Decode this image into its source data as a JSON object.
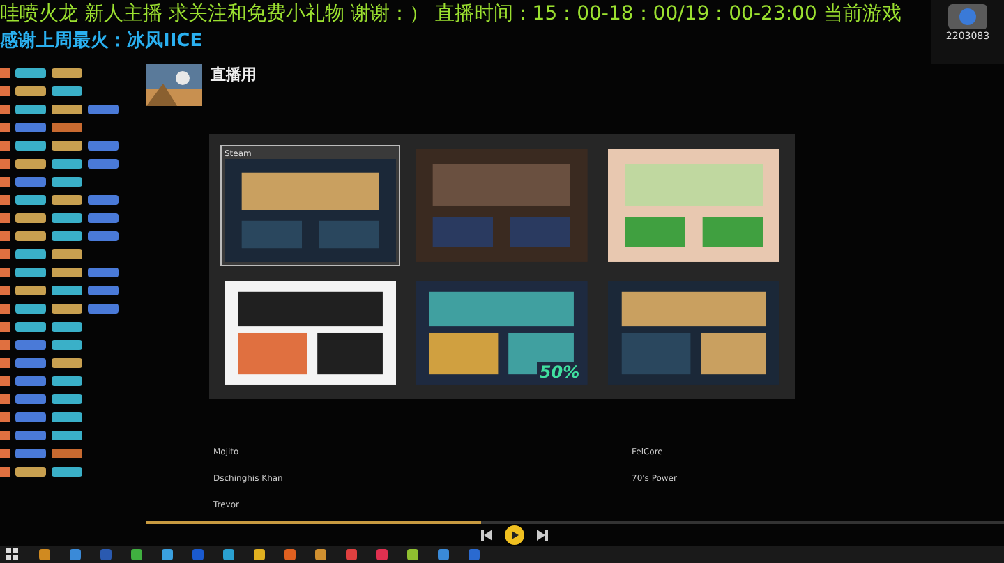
{
  "banner": {
    "line": "哇喷火龙 新人主播 求关注和免费小礼物 谢谢：） 直播时间：15：00-18：00/19：00-23:00 当前游戏",
    "thanks": "感谢上周最火：冰风IICE"
  },
  "logo": {
    "room_number": "2203083"
  },
  "playlist": {
    "title": "直播用"
  },
  "chat": [
    {
      "badges": [
        {
          "color": "#3ab0c8"
        },
        {
          "color": "#c8a050"
        }
      ]
    },
    {
      "badges": [
        {
          "color": "#c8a050"
        },
        {
          "color": "#3ab0c8"
        }
      ]
    },
    {
      "badges": [
        {
          "color": "#3ab0c8"
        },
        {
          "color": "#c8a050"
        },
        {
          "color": "#4a7ad8"
        }
      ]
    },
    {
      "badges": [
        {
          "color": "#4a7ad8"
        },
        {
          "color": "#c86a30"
        }
      ]
    },
    {
      "badges": [
        {
          "color": "#3ab0c8"
        },
        {
          "color": "#c8a050"
        },
        {
          "color": "#4a7ad8"
        }
      ]
    },
    {
      "badges": [
        {
          "color": "#c8a050"
        },
        {
          "color": "#3ab0c8"
        },
        {
          "color": "#4a7ad8"
        }
      ]
    },
    {
      "badges": [
        {
          "color": "#4a7ad8"
        },
        {
          "color": "#3ab0c8"
        }
      ]
    },
    {
      "badges": [
        {
          "color": "#3ab0c8"
        },
        {
          "color": "#c8a050"
        },
        {
          "color": "#4a7ad8"
        }
      ]
    },
    {
      "badges": [
        {
          "color": "#c8a050"
        },
        {
          "color": "#3ab0c8"
        },
        {
          "color": "#4a7ad8"
        }
      ]
    },
    {
      "badges": [
        {
          "color": "#c8a050"
        },
        {
          "color": "#3ab0c8"
        },
        {
          "color": "#4a7ad8"
        }
      ]
    },
    {
      "badges": [
        {
          "color": "#3ab0c8"
        },
        {
          "color": "#c8a050"
        }
      ]
    },
    {
      "badges": [
        {
          "color": "#3ab0c8"
        },
        {
          "color": "#c8a050"
        },
        {
          "color": "#4a7ad8"
        }
      ]
    },
    {
      "badges": [
        {
          "color": "#c8a050"
        },
        {
          "color": "#3ab0c8"
        },
        {
          "color": "#4a7ad8"
        }
      ]
    },
    {
      "badges": [
        {
          "color": "#3ab0c8"
        },
        {
          "color": "#c8a050"
        },
        {
          "color": "#4a7ad8"
        }
      ]
    },
    {
      "badges": [
        {
          "color": "#3ab0c8"
        },
        {
          "color": "#3ab0c8"
        }
      ]
    },
    {
      "badges": [
        {
          "color": "#4a7ad8"
        },
        {
          "color": "#3ab0c8"
        }
      ]
    },
    {
      "badges": [
        {
          "color": "#4a7ad8"
        },
        {
          "color": "#c8a050"
        }
      ]
    },
    {
      "badges": [
        {
          "color": "#4a7ad8"
        },
        {
          "color": "#3ab0c8"
        }
      ]
    },
    {
      "badges": [
        {
          "color": "#4a7ad8"
        },
        {
          "color": "#3ab0c8"
        }
      ]
    },
    {
      "badges": [
        {
          "color": "#4a7ad8"
        },
        {
          "color": "#3ab0c8"
        }
      ]
    },
    {
      "badges": [
        {
          "color": "#4a7ad8"
        },
        {
          "color": "#3ab0c8"
        }
      ]
    },
    {
      "badges": [
        {
          "color": "#4a7ad8"
        },
        {
          "color": "#c86a30"
        }
      ]
    },
    {
      "badges": [
        {
          "color": "#c8a050"
        },
        {
          "color": "#3ab0c8"
        }
      ]
    }
  ],
  "switcher": {
    "top": [
      {
        "title": "Steam",
        "selected": true,
        "kind": "app"
      },
      {
        "selected": false,
        "kind": "game"
      },
      {
        "selected": false,
        "kind": "art"
      }
    ],
    "bottom": [
      {
        "selected": false,
        "kind": "browser"
      },
      {
        "selected": false,
        "kind": "launcher",
        "promo": "50%"
      },
      {
        "selected": false,
        "kind": "app"
      }
    ]
  },
  "songs": [
    {
      "left": "Mojito",
      "right": "FelCore"
    },
    {
      "left": "Dschinghis Khan",
      "right": "70's Power"
    },
    {
      "left": "Trevor"
    }
  ],
  "player": {
    "level": 0.37
  },
  "taskbar": {
    "icons": [
      {
        "color": "#d08a20"
      },
      {
        "color": "#3a8ad8"
      },
      {
        "color": "#2a5ab0"
      },
      {
        "color": "#40b040"
      },
      {
        "color": "#3aa0e0"
      },
      {
        "color": "#1a5ad0"
      },
      {
        "color": "#2aa0d0"
      },
      {
        "color": "#e0b020"
      },
      {
        "color": "#e06020"
      },
      {
        "color": "#d09030"
      },
      {
        "color": "#e04040"
      },
      {
        "color": "#e03050"
      },
      {
        "color": "#90c030"
      },
      {
        "color": "#3a8ad8"
      },
      {
        "color": "#2a6ad0"
      }
    ]
  }
}
